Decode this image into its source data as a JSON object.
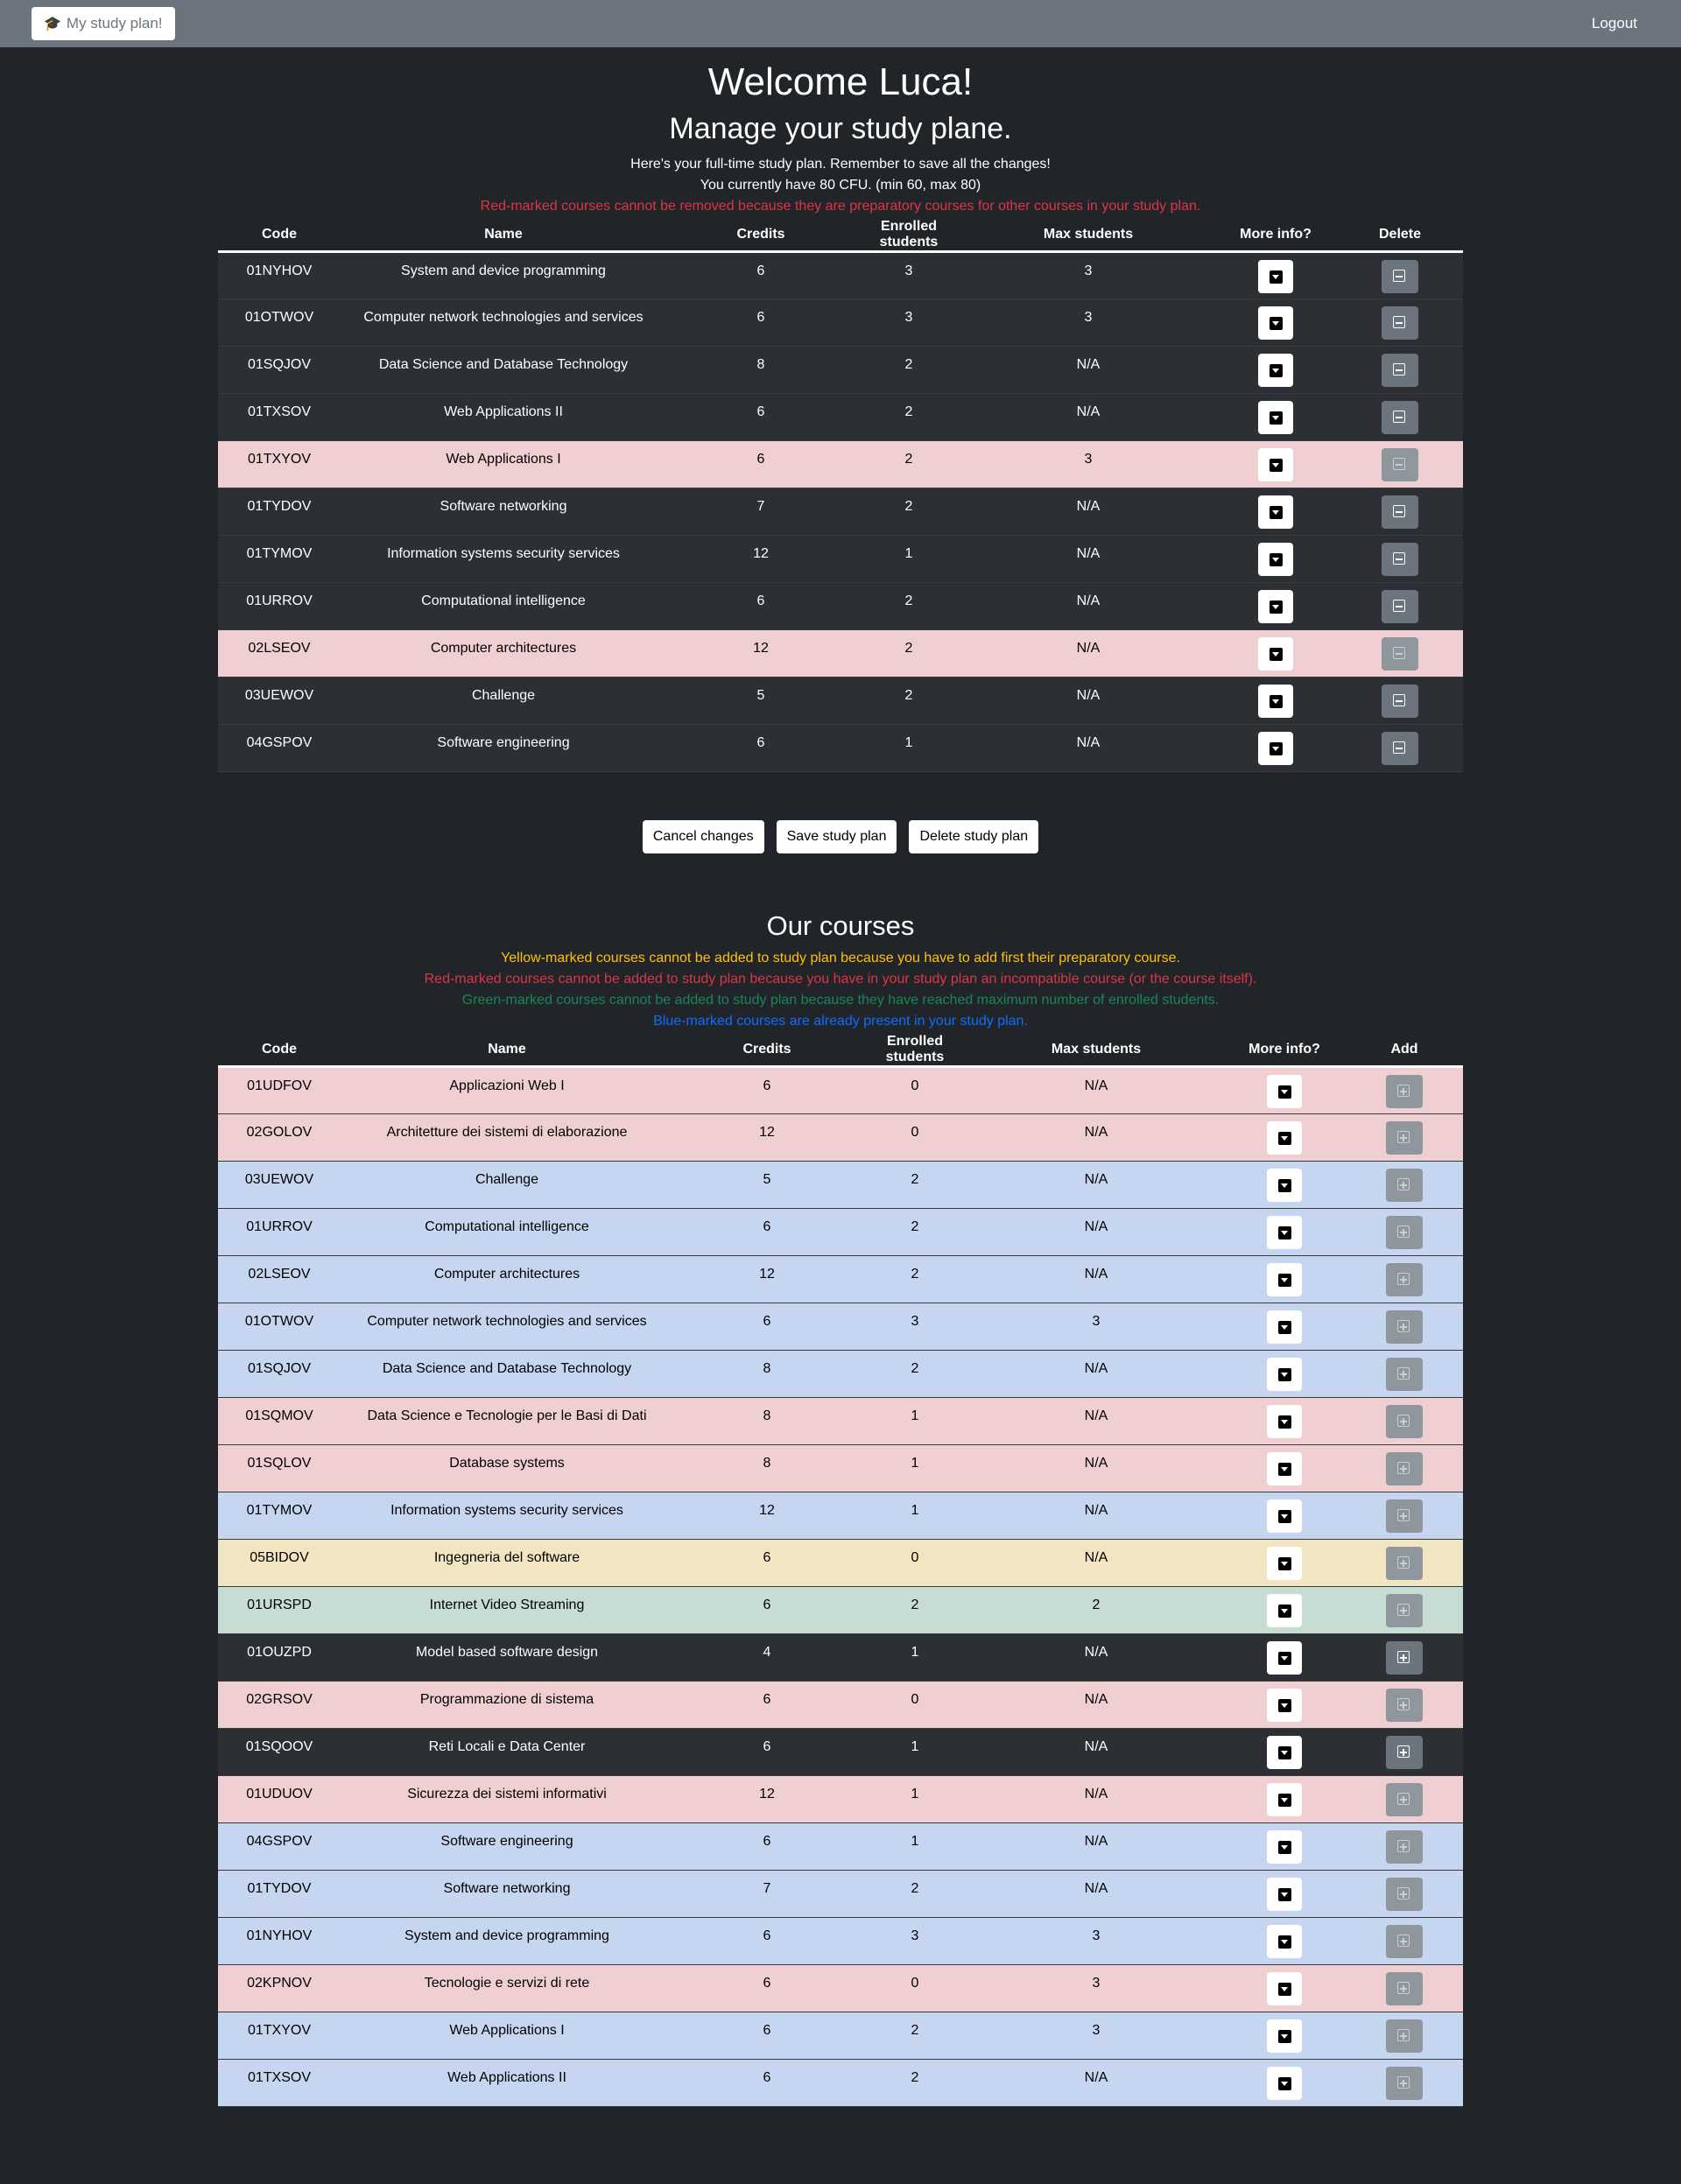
{
  "navbar": {
    "brand_label": "My study plan!",
    "logout_label": "Logout"
  },
  "header": {
    "welcome": "Welcome Luca!",
    "subtitle": "Manage your study plane.",
    "info_line": "Here's your full-time study plan. Remember to save all the changes!",
    "credits_line": "You currently have 80 CFU. (min 60, max 80)",
    "red_note": "Red-marked courses cannot be removed because they are preparatory courses for other courses in your study plan."
  },
  "study_plan": {
    "columns": [
      "Code",
      "Name",
      "Credits",
      "Enrolled students",
      "Max students",
      "More info?",
      "Delete"
    ],
    "rows": [
      {
        "code": "01NYHOV",
        "name": "System and device programming",
        "credits": "6",
        "enrolled": "3",
        "max": "3",
        "mark": "plain"
      },
      {
        "code": "01OTWOV",
        "name": "Computer network technologies and services",
        "credits": "6",
        "enrolled": "3",
        "max": "3",
        "mark": "plain"
      },
      {
        "code": "01SQJOV",
        "name": "Data Science and Database Technology",
        "credits": "8",
        "enrolled": "2",
        "max": "N/A",
        "mark": "plain"
      },
      {
        "code": "01TXSOV",
        "name": "Web Applications II",
        "credits": "6",
        "enrolled": "2",
        "max": "N/A",
        "mark": "plain"
      },
      {
        "code": "01TXYOV",
        "name": "Web Applications I",
        "credits": "6",
        "enrolled": "2",
        "max": "3",
        "mark": "red"
      },
      {
        "code": "01TYDOV",
        "name": "Software networking",
        "credits": "7",
        "enrolled": "2",
        "max": "N/A",
        "mark": "plain"
      },
      {
        "code": "01TYMOV",
        "name": "Information systems security services",
        "credits": "12",
        "enrolled": "1",
        "max": "N/A",
        "mark": "plain"
      },
      {
        "code": "01URROV",
        "name": "Computational intelligence",
        "credits": "6",
        "enrolled": "2",
        "max": "N/A",
        "mark": "plain"
      },
      {
        "code": "02LSEOV",
        "name": "Computer architectures",
        "credits": "12",
        "enrolled": "2",
        "max": "N/A",
        "mark": "red"
      },
      {
        "code": "03UEWOV",
        "name": "Challenge",
        "credits": "5",
        "enrolled": "2",
        "max": "N/A",
        "mark": "plain"
      },
      {
        "code": "04GSPOV",
        "name": "Software engineering",
        "credits": "6",
        "enrolled": "1",
        "max": "N/A",
        "mark": "plain"
      }
    ]
  },
  "actions": {
    "cancel": "Cancel changes",
    "save": "Save study plan",
    "delete": "Delete study plan"
  },
  "our_courses": {
    "title": "Our courses",
    "notes": {
      "yellow": "Yellow-marked courses cannot be added to study plan because you have to add first their preparatory course.",
      "red": "Red-marked courses cannot be added to study plan because you have in your study plan an incompatible course (or the course itself).",
      "green": "Green-marked courses cannot be added to study plan because they have reached maximum number of enrolled students.",
      "blue": "Blue-marked courses are already present in your study plan."
    },
    "columns": [
      "Code",
      "Name",
      "Credits",
      "Enrolled students",
      "Max students",
      "More info?",
      "Add"
    ],
    "rows": [
      {
        "code": "01UDFOV",
        "name": "Applicazioni Web I",
        "credits": "6",
        "enrolled": "0",
        "max": "N/A",
        "mark": "red"
      },
      {
        "code": "02GOLOV",
        "name": "Architetture dei sistemi di elaborazione",
        "credits": "12",
        "enrolled": "0",
        "max": "N/A",
        "mark": "red"
      },
      {
        "code": "03UEWOV",
        "name": "Challenge",
        "credits": "5",
        "enrolled": "2",
        "max": "N/A",
        "mark": "blue"
      },
      {
        "code": "01URROV",
        "name": "Computational intelligence",
        "credits": "6",
        "enrolled": "2",
        "max": "N/A",
        "mark": "blue"
      },
      {
        "code": "02LSEOV",
        "name": "Computer architectures",
        "credits": "12",
        "enrolled": "2",
        "max": "N/A",
        "mark": "blue"
      },
      {
        "code": "01OTWOV",
        "name": "Computer network technologies and services",
        "credits": "6",
        "enrolled": "3",
        "max": "3",
        "mark": "blue"
      },
      {
        "code": "01SQJOV",
        "name": "Data Science and Database Technology",
        "credits": "8",
        "enrolled": "2",
        "max": "N/A",
        "mark": "blue"
      },
      {
        "code": "01SQMOV",
        "name": "Data Science e Tecnologie per le Basi di Dati",
        "credits": "8",
        "enrolled": "1",
        "max": "N/A",
        "mark": "red"
      },
      {
        "code": "01SQLOV",
        "name": "Database systems",
        "credits": "8",
        "enrolled": "1",
        "max": "N/A",
        "mark": "red"
      },
      {
        "code": "01TYMOV",
        "name": "Information systems security services",
        "credits": "12",
        "enrolled": "1",
        "max": "N/A",
        "mark": "blue"
      },
      {
        "code": "05BIDOV",
        "name": "Ingegneria del software",
        "credits": "6",
        "enrolled": "0",
        "max": "N/A",
        "mark": "yellow"
      },
      {
        "code": "01URSPD",
        "name": "Internet Video Streaming",
        "credits": "6",
        "enrolled": "2",
        "max": "2",
        "mark": "green"
      },
      {
        "code": "01OUZPD",
        "name": "Model based software design",
        "credits": "4",
        "enrolled": "1",
        "max": "N/A",
        "mark": "plain"
      },
      {
        "code": "02GRSOV",
        "name": "Programmazione di sistema",
        "credits": "6",
        "enrolled": "0",
        "max": "N/A",
        "mark": "red"
      },
      {
        "code": "01SQOOV",
        "name": "Reti Locali e Data Center",
        "credits": "6",
        "enrolled": "1",
        "max": "N/A",
        "mark": "plain"
      },
      {
        "code": "01UDUOV",
        "name": "Sicurezza dei sistemi informativi",
        "credits": "12",
        "enrolled": "1",
        "max": "N/A",
        "mark": "red"
      },
      {
        "code": "04GSPOV",
        "name": "Software engineering",
        "credits": "6",
        "enrolled": "1",
        "max": "N/A",
        "mark": "blue"
      },
      {
        "code": "01TYDOV",
        "name": "Software networking",
        "credits": "7",
        "enrolled": "2",
        "max": "N/A",
        "mark": "blue"
      },
      {
        "code": "01NYHOV",
        "name": "System and device programming",
        "credits": "6",
        "enrolled": "3",
        "max": "3",
        "mark": "blue"
      },
      {
        "code": "02KPNOV",
        "name": "Tecnologie e servizi di rete",
        "credits": "6",
        "enrolled": "0",
        "max": "3",
        "mark": "red"
      },
      {
        "code": "01TXYOV",
        "name": "Web Applications I",
        "credits": "6",
        "enrolled": "2",
        "max": "3",
        "mark": "blue"
      },
      {
        "code": "01TXSOV",
        "name": "Web Applications II",
        "credits": "6",
        "enrolled": "2",
        "max": "N/A",
        "mark": "blue"
      }
    ]
  },
  "icons": {
    "brand": "graduation-cap-icon",
    "more_info": "caret-down-square-icon",
    "delete": "dash-square-icon",
    "add": "plus-square-icon"
  },
  "colors": {
    "background": "#212529",
    "navbar": "#6c757d",
    "red_row": "#f0cfd3",
    "blue_row": "#c7d6f0",
    "yellow_row": "#f2e6c2",
    "green_row": "#c7dcd3",
    "red_text": "#dc3545",
    "yellow_text": "#ffc107",
    "green_text": "#198754",
    "blue_text": "#0d6efd"
  }
}
